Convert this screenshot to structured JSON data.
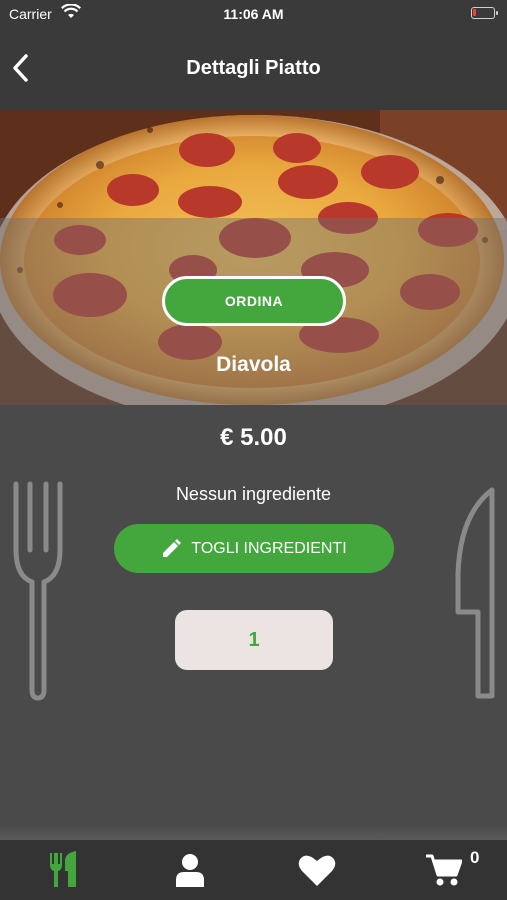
{
  "status_bar": {
    "carrier": "Carrier",
    "time": "11:06 AM"
  },
  "nav": {
    "title": "Dettagli Piatto"
  },
  "dish": {
    "order_label": "ORDINA",
    "name": "Diavola",
    "price": "€ 5.00",
    "ingredients_text": "Nessun ingrediente",
    "remove_ingredients_label": "TOGLI INGREDIENTI",
    "quantity": "1"
  },
  "tabs": [
    {
      "icon": "cutlery-icon",
      "active": true
    },
    {
      "icon": "user-icon",
      "active": false
    },
    {
      "icon": "heart-icon",
      "active": false
    },
    {
      "icon": "cart-icon",
      "active": false
    }
  ],
  "cart": {
    "count": "0"
  },
  "colors": {
    "accent": "#43a73e",
    "bar": "#333333",
    "background": "#4a4a4a",
    "quantity_bg": "#ece4e2"
  }
}
